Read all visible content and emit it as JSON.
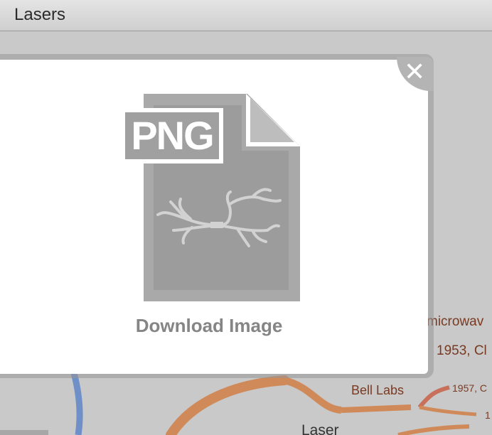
{
  "window": {
    "title": "Lasers"
  },
  "dialog": {
    "file_format": "PNG",
    "download_label": "Download Image",
    "close_symbol": "✕",
    "icons": {
      "close": "close-icon",
      "file": "png-file-icon",
      "preview": "mindmap-preview-icon"
    }
  },
  "map": {
    "labels": [
      {
        "text": "microwav",
        "color": "#7a3a22"
      },
      {
        "text": "1953, Cl",
        "color": "#7a3a22"
      },
      {
        "text": "Bell Labs",
        "color": "#7a3a22"
      },
      {
        "text": "1957, C",
        "color": "#7a3a22"
      },
      {
        "text": "1",
        "color": "#7a3a22"
      },
      {
        "text": "Laser",
        "color": "#333333"
      }
    ],
    "colors": {
      "branch_blue": "#6f8fc8",
      "branch_orange": "#d08a5a",
      "branch_red": "#c8705a"
    }
  }
}
